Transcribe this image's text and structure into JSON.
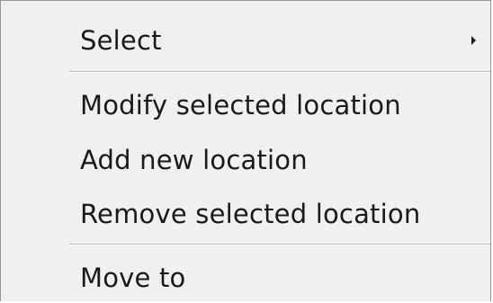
{
  "menu": {
    "items": [
      {
        "label": "Select",
        "has_submenu": true
      },
      {
        "label": "Modify selected location",
        "has_submenu": false
      },
      {
        "label": "Add new location",
        "has_submenu": false
      },
      {
        "label": "Remove selected location",
        "has_submenu": false
      },
      {
        "label": "Move to",
        "has_submenu": false
      }
    ],
    "submenu_icon": "chevron-right-icon"
  },
  "colors": {
    "menu_background": "#f0f0f0",
    "border": "#979797",
    "separator": "#bdbdbd",
    "text": "#1a1a1a"
  }
}
